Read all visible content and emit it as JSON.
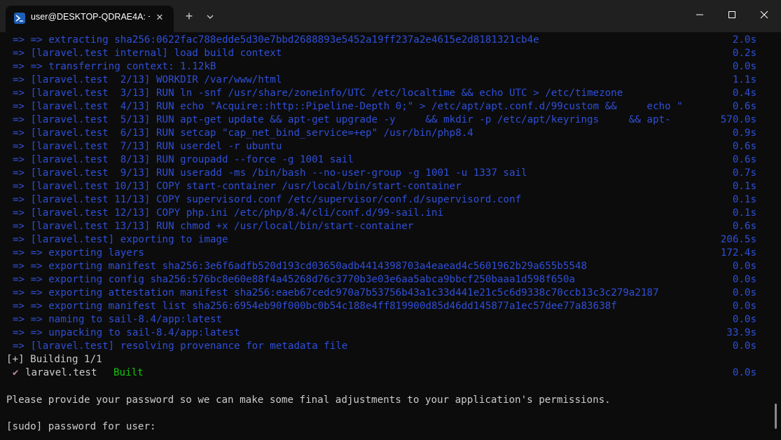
{
  "window": {
    "tab_title": "user@DESKTOP-QDRAE4A: ~",
    "tab_close": "✕",
    "new_tab": "+",
    "icons": {
      "tab": "powershell-icon",
      "dropdown": "chevron-down-icon",
      "minimize": "minimize-icon",
      "maximize": "maximize-icon",
      "close": "close-icon"
    }
  },
  "colors": {
    "background": "#0c0c0c",
    "titlebar": "#202020",
    "log_blue": "#2f4fd8",
    "default_text": "#cccccc",
    "built_green": "#16c60c",
    "check_purple": "#b48ead"
  },
  "build_log": [
    {
      "text": "=> => extracting sha256:0622fac788edde5d30e7bbd2688893e5452a19ff237a2e4615e2d8181321cb4e",
      "time": "2.0s"
    },
    {
      "text": "=> [laravel.test internal] load build context",
      "time": "0.2s"
    },
    {
      "text": "=> => transferring context: 1.12kB",
      "time": "0.0s"
    },
    {
      "text": "=> [laravel.test  2/13] WORKDIR /var/www/html",
      "time": "1.1s"
    },
    {
      "text": "=> [laravel.test  3/13] RUN ln -snf /usr/share/zoneinfo/UTC /etc/localtime && echo UTC > /etc/timezone",
      "time": "0.4s"
    },
    {
      "text": "=> [laravel.test  4/13] RUN echo \"Acquire::http::Pipeline-Depth 0;\" > /etc/apt/apt.conf.d/99custom &&     echo \"",
      "time": "0.6s"
    },
    {
      "text": "=> [laravel.test  5/13] RUN apt-get update && apt-get upgrade -y     && mkdir -p /etc/apt/keyrings     && apt-",
      "time": "570.0s"
    },
    {
      "text": "=> [laravel.test  6/13] RUN setcap \"cap_net_bind_service=+ep\" /usr/bin/php8.4",
      "time": "0.9s"
    },
    {
      "text": "=> [laravel.test  7/13] RUN userdel -r ubuntu",
      "time": "0.6s"
    },
    {
      "text": "=> [laravel.test  8/13] RUN groupadd --force -g 1001 sail",
      "time": "0.6s"
    },
    {
      "text": "=> [laravel.test  9/13] RUN useradd -ms /bin/bash --no-user-group -g 1001 -u 1337 sail",
      "time": "0.7s"
    },
    {
      "text": "=> [laravel.test 10/13] COPY start-container /usr/local/bin/start-container",
      "time": "0.1s"
    },
    {
      "text": "=> [laravel.test 11/13] COPY supervisord.conf /etc/supervisor/conf.d/supervisord.conf",
      "time": "0.1s"
    },
    {
      "text": "=> [laravel.test 12/13] COPY php.ini /etc/php/8.4/cli/conf.d/99-sail.ini",
      "time": "0.1s"
    },
    {
      "text": "=> [laravel.test 13/13] RUN chmod +x /usr/local/bin/start-container",
      "time": "0.6s"
    },
    {
      "text": "=> [laravel.test] exporting to image",
      "time": "206.5s"
    },
    {
      "text": "=> => exporting layers",
      "time": "172.4s"
    },
    {
      "text": "=> => exporting manifest sha256:3e6f6adfb520d193cd03650adb4414398703a4eaead4c5601962b29a655b5548",
      "time": "0.0s"
    },
    {
      "text": "=> => exporting config sha256:576bc8e60e88f4a45268d76c3770b3e03e6aa5abca9bbcf250baaa1d598f650a",
      "time": "0.0s"
    },
    {
      "text": "=> => exporting attestation manifest sha256:eaeb67cedc970a7b53756b43a1c33d441e21c5c6d9338c70ccb13c3c279a2187",
      "time": "0.0s"
    },
    {
      "text": "=> => exporting manifest list sha256:6954eb90f000bc0b54c188e4ff819900d85d46dd145877a1ec57dee77a83638f",
      "time": "0.0s"
    },
    {
      "text": "=> => naming to sail-8.4/app:latest",
      "time": "0.0s"
    },
    {
      "text": "=> => unpacking to sail-8.4/app:latest",
      "time": "33.9s"
    },
    {
      "text": "=> [laravel.test] resolving provenance for metadata file",
      "time": "0.0s"
    }
  ],
  "building_status": "[+] Building 1/1",
  "built_row": {
    "check": "✔",
    "service": "laravel.test",
    "status": "Built",
    "time": "0.0s"
  },
  "password_message": "Please provide your password so we can make some final adjustments to your application's permissions.",
  "sudo_prompt": "[sudo] password for user:"
}
